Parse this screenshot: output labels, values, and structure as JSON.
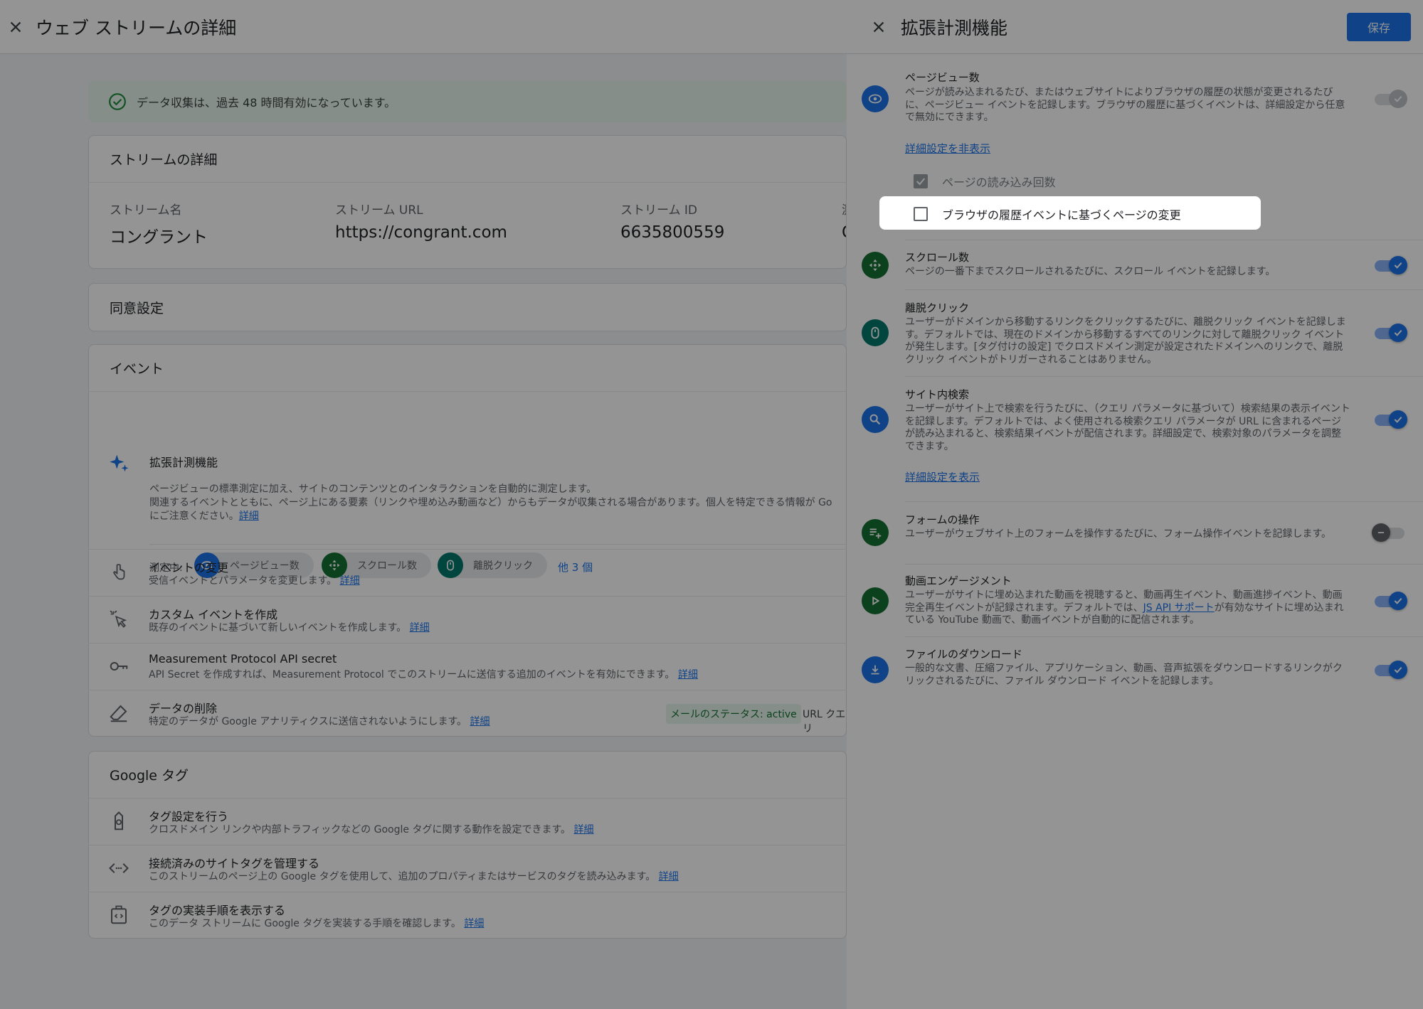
{
  "left_page": {
    "title": "ウェブ ストリームの詳細",
    "banner_text": "データ収集は、過去 48 時間有効になっています。",
    "stream_details": {
      "title": "ストリームの詳細",
      "name_label": "ストリーム名",
      "name_value": "コングラント",
      "url_label": "ストリーム URL",
      "url_value": "https://congrant.com",
      "id_label": "ストリーム ID",
      "id_value": "6635800559",
      "cut_label": "測",
      "cut_value": "G"
    },
    "consent_title": "同意設定",
    "events": {
      "title": "イベント",
      "enhanced": {
        "title": "拡張計測機能",
        "desc1": "ページビューの標準測定に加え、サイトのコンテンツとのインタラクションを自動的に測定します。",
        "desc2": "関連するイベントとともに、ページ上にある要素（リンクや埋め込み動画など）からもデータが収集される場合があります。個人を特定できる情報が Go",
        "desc3": "にご注意ください。",
        "link": "詳細",
        "measuring_label": "測定中:",
        "chips": [
          "ページビュー数",
          "スクロール数",
          "離脱クリック"
        ],
        "more": "他 3 個"
      },
      "modify": {
        "title": "イベントの変更",
        "desc": "受信イベントとパラメータを変更します。",
        "link": "詳細"
      },
      "custom": {
        "title": "カスタム イベントを作成",
        "desc": "既存のイベントに基づいて新しいイベントを作成します。",
        "link": "詳細"
      },
      "mp": {
        "title": "Measurement Protocol API secret",
        "desc": "API Secret を作成すれば、Measurement Protocol でこのストリームに送信する追加のイベントを有効にできます。",
        "link": "詳細"
      },
      "redact": {
        "title": "データの削除",
        "desc": "特定のデータが Google アナリティクスに送信されないようにします。",
        "link": "詳細",
        "tag": "メールのステータス: active",
        "tag2": "URL クエリ"
      }
    },
    "google_tag": {
      "title": "Google タグ",
      "configure": {
        "title": "タグ設定を行う",
        "desc": "クロスドメイン リンクや内部トラフィックなどの Google タグに関する動作を設定できます。",
        "link": "詳細"
      },
      "connected": {
        "title": "接続済みのサイトタグを管理する",
        "desc": "このストリームのページ上の Google タグを使用して、追加のプロパティまたはサービスのタグを読み込みます。",
        "link": "詳細"
      },
      "install": {
        "title": "タグの実装手順を表示する",
        "desc": "このデータ ストリームに Google タグを実装する手順を確認します。",
        "link": "詳細"
      }
    }
  },
  "panel": {
    "title": "拡張計測機能",
    "save_label": "保存",
    "pageviews": {
      "title": "ページビュー数",
      "desc": "ページが読み込まれるたび、またはウェブサイトによりブラウザの履歴の状態が変更されるたびに、ページビュー イベントを記録します。ブラウザの履歴に基づくイベントは、詳細設定から任意で無効にできます。",
      "link": "詳細設定を非表示",
      "option1": "ページの読み込み回数",
      "option2": "ブラウザの履歴イベントに基づくページの変更",
      "option1_checked": true,
      "option2_checked": false,
      "enabled": true
    },
    "scrolls": {
      "title": "スクロール数",
      "desc": "ページの一番下までスクロールされるたびに、スクロール イベントを記録します。",
      "enabled": true
    },
    "outbound": {
      "title": "離脱クリック",
      "desc": "ユーザーがドメインから移動するリンクをクリックするたびに、離脱クリック イベントを記録します。デフォルトでは、現在のドメインから移動するすべてのリンクに対して離脱クリック イベントが発生します。[タグ付けの設定] でクロスドメイン測定が設定されたドメインへのリンクで、離脱クリック イベントがトリガーされることはありません。",
      "enabled": true
    },
    "site_search": {
      "title": "サイト内検索",
      "desc": "ユーザーがサイト上で検索を行うたびに、（クエリ パラメータに基づいて）検索結果の表示イベントを記録します。デフォルトでは、よく使用される検索クエリ パラメータが URL に含まれるページが読み込まれると、検索結果イベントが配信されます。詳細設定で、検索対象のパラメータを調整できます。",
      "link": "詳細設定を表示",
      "enabled": true
    },
    "forms": {
      "title": "フォームの操作",
      "desc": "ユーザーがウェブサイト上のフォームを操作するたびに、フォーム操作イベントを記録します。",
      "enabled": false
    },
    "video": {
      "title": "動画エンゲージメント",
      "desc1": "ユーザーがサイトに埋め込まれた動画を視聴すると、動画再生イベント、動画進捗イベント、動画完全再生イベントが記録されます。デフォルトでは、",
      "link": "JS API サポート",
      "desc2": "が有効なサイトに埋め込まれている YouTube 動画で、動画イベントが自動的に配信されます。",
      "enabled": true
    },
    "downloads": {
      "title": "ファイルのダウンロード",
      "desc": "一般的な文書、圧縮ファイル、アプリケーション、動画、音声拡張をダウンロードするリンクがクリックされるたびに、ファイル ダウンロード イベントを記録します。",
      "enabled": true
    }
  },
  "colors": {
    "primary": "#1a73e8",
    "green": "#137333",
    "teal": "#00796b",
    "success": "#1e8e3e"
  }
}
